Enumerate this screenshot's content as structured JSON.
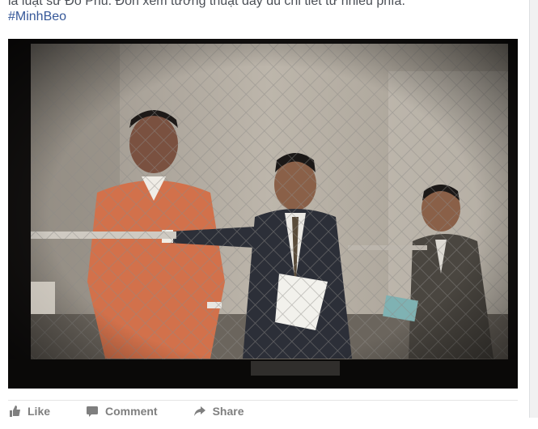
{
  "post": {
    "truncated_text": "là luật sư Đỗ Phủ. Đón xem tường thuật đầy đủ chi tiết từ nhiều phía.",
    "hashtag": "#MinhBeo",
    "photo_alt": "courtroom-photo"
  },
  "actions": {
    "like_label": "Like",
    "comment_label": "Comment",
    "share_label": "Share"
  },
  "colors": {
    "link": "#365899",
    "text": "#4b4f56",
    "action_text": "#7f7f7f"
  }
}
